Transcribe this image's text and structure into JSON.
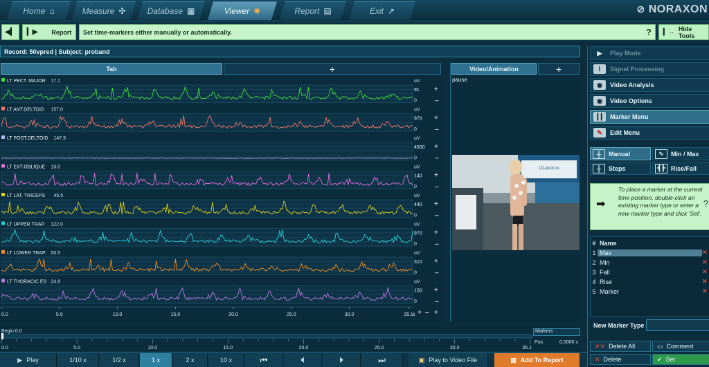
{
  "nav": {
    "tabs": [
      {
        "label": "Home",
        "icon": "home-icon"
      },
      {
        "label": "Measure",
        "icon": "measure-icon"
      },
      {
        "label": "Database",
        "icon": "database-icon"
      },
      {
        "label": "Viewer",
        "icon": "viewer-icon",
        "active": true
      },
      {
        "label": "Report",
        "icon": "report-icon"
      },
      {
        "label": "Exit",
        "icon": "exit-icon"
      }
    ],
    "brand": "NORAXON"
  },
  "toolbar": {
    "report_label": "Report",
    "hint": "Set time-markers either manually or automatically.",
    "help": "?",
    "hide_tools_label": "Hide Tools"
  },
  "record": {
    "text": "Record: 50vpred | Subject: proband"
  },
  "chart_panel": {
    "tab_label": "Tab",
    "add_tab": "+",
    "time_unit": "s"
  },
  "chart_data": {
    "type": "line",
    "unit": "uV",
    "x_axis": {
      "min": 0,
      "max": 35.1,
      "ticks": [
        "0.0",
        "5.0",
        "10.0",
        "15.0",
        "20.0",
        "25.0",
        "30.0",
        "35.1"
      ]
    },
    "series": [
      {
        "name": "LT PECT. MAJOR",
        "value": "17.1",
        "ymax": "91",
        "color": "#3fdc3f"
      },
      {
        "name": "LT ANT.DELTOID",
        "value": "157.0",
        "ymax": "970",
        "color": "#f0766a"
      },
      {
        "name": "LT POST.DELTOID",
        "value": "147.9",
        "ymax": "4500",
        "color": "#b8b8f4"
      },
      {
        "name": "LT EXT.OBLIQUE",
        "value": "13.0",
        "ymax": "140",
        "color": "#e46fe0"
      },
      {
        "name": "LT LAT. TRICEPS",
        "value": "45.5",
        "ymax": "440",
        "color": "#d8d020"
      },
      {
        "name": "LT UPPER TRAP.",
        "value": "122.0",
        "ymax": "970",
        "color": "#25cfd6"
      },
      {
        "name": "LT LOWER TRAP.",
        "value": "50.5",
        "ymax": "310",
        "color": "#f08f22"
      },
      {
        "name": "LT THORACIC ES",
        "value": "24.8",
        "ymax": "150",
        "color": "#b77ae4"
      }
    ],
    "ymin_label": "0"
  },
  "video": {
    "title": "Video/Animation",
    "add": "+",
    "status": "pause",
    "banner_text": "LD-pool.co"
  },
  "right_menu": {
    "items": [
      {
        "label": "Play Mode",
        "icon": "play-icon",
        "dim": true
      },
      {
        "label": "Signal Processing",
        "icon": "signal-processing-icon",
        "dim": true
      },
      {
        "label": "Video Analysis",
        "icon": "camera-icon"
      },
      {
        "label": "Video Options",
        "icon": "camera-options-icon"
      },
      {
        "label": "Marker Menu",
        "icon": "marker-icon",
        "active": true
      },
      {
        "label": "Edit Menu",
        "icon": "edit-icon"
      }
    ],
    "marker_types": [
      {
        "label": "Manual",
        "icon": "manual-icon",
        "active": true
      },
      {
        "label": "Min / Max",
        "icon": "minmax-icon"
      },
      {
        "label": "Steps",
        "icon": "steps-icon"
      },
      {
        "label": "Rise/Fall",
        "icon": "risefall-icon"
      }
    ],
    "info": "To place a marker at the current time position, double-click an existing marker type or enter a new marker type and click 'Set'.",
    "info_help": "?"
  },
  "marker_table": {
    "header_num": "#",
    "header_name": "Name",
    "rows": [
      {
        "num": "1",
        "name": "Max",
        "selected": true
      },
      {
        "num": "2",
        "name": "Min"
      },
      {
        "num": "3",
        "name": "Fall"
      },
      {
        "num": "4",
        "name": "Rise"
      },
      {
        "num": "5",
        "name": "Marker"
      }
    ]
  },
  "new_marker_type": {
    "label": "New Marker Type",
    "value": ""
  },
  "marker_buttons": {
    "delete_all": "Delete All",
    "comment": "Comment",
    "delete": "Delete",
    "set": "Set"
  },
  "timeline": {
    "begin_label": "Begin 0.0",
    "markers_label": "Markers",
    "pos_label": "Pos",
    "pos_value": "0.0000 s",
    "ticks": [
      "0.0",
      "5.0",
      "10.0",
      "15.0",
      "20.0",
      "25.0",
      "30.0",
      "35.1"
    ]
  },
  "controls": {
    "play": "Play",
    "speeds": [
      "1/10 x",
      "1/2 x",
      "1 x",
      "2 x",
      "10 x"
    ],
    "active_speed": "1 x",
    "play_to_video": "Play to Video File",
    "add_to_report": "Add To Report"
  }
}
